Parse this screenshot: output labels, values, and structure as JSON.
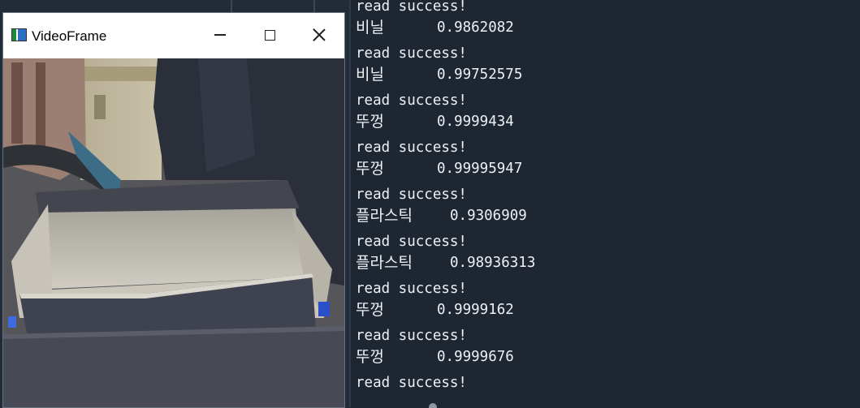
{
  "video_window": {
    "title": "VideoFrame",
    "icon": "app-icon",
    "controls": {
      "minimize_icon": "minimize-icon",
      "maximize_icon": "maximize-icon",
      "close_icon": "close-icon"
    }
  },
  "console": {
    "lines": [
      {
        "text": "read success!"
      },
      {
        "label": "비닐",
        "score": "0.9862082"
      },
      {
        "text": "read success!"
      },
      {
        "label": "비닐",
        "score": "0.99752575"
      },
      {
        "text": "read success!"
      },
      {
        "label": "뚜껑",
        "score": "0.9999434"
      },
      {
        "text": "read success!"
      },
      {
        "label": "뚜껑",
        "score": "0.99995947"
      },
      {
        "text": "read success!"
      },
      {
        "label": "플라스틱",
        "score": "0.9306909"
      },
      {
        "text": "read success!"
      },
      {
        "label": "플라스틱",
        "score": "0.98936313"
      },
      {
        "text": "read success!"
      },
      {
        "label": "뚜껑",
        "score": "0.9999162"
      },
      {
        "text": "read success!"
      },
      {
        "label": "뚜껑",
        "score": "0.9999676"
      },
      {
        "text": "read success!"
      }
    ]
  },
  "colors": {
    "console_background": "#1e2632",
    "console_text": "#eef1f5",
    "window_background": "#ffffff"
  }
}
